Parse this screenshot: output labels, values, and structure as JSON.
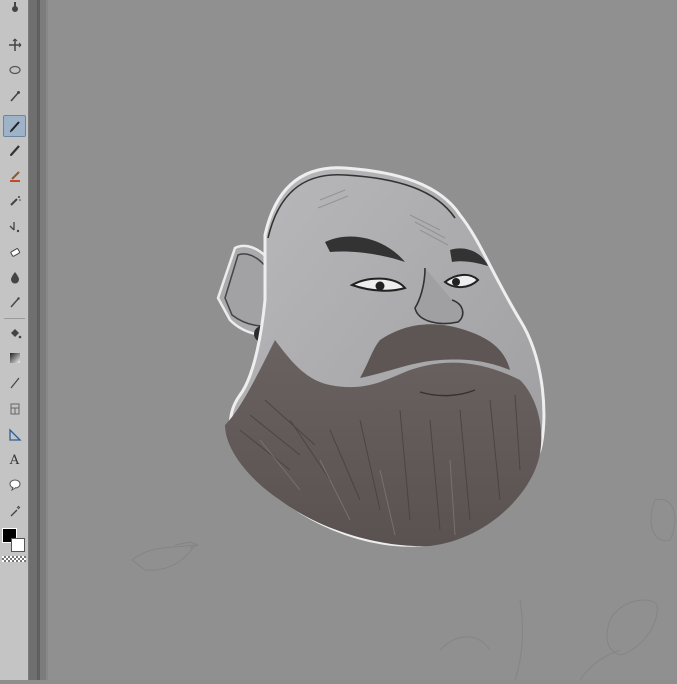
{
  "toolbar": {
    "tools": [
      {
        "icon": "eyedropper-icon",
        "active": false
      },
      {
        "icon": "move-icon",
        "active": false
      },
      {
        "icon": "lasso-icon",
        "active": false
      },
      {
        "icon": "magic-wand-icon",
        "active": false
      },
      {
        "icon": "pen-icon",
        "active": true
      },
      {
        "icon": "pencil-icon",
        "active": false
      },
      {
        "icon": "brush-icon",
        "active": false
      },
      {
        "icon": "airbrush-icon",
        "active": false
      },
      {
        "icon": "decoration-icon",
        "active": false
      },
      {
        "icon": "eraser-icon",
        "active": false
      },
      {
        "icon": "blend-icon",
        "active": false
      },
      {
        "icon": "eyedropper-small-icon",
        "active": false
      },
      {
        "icon": "fill-icon",
        "active": false
      },
      {
        "icon": "gradient-icon",
        "active": false
      },
      {
        "icon": "line-icon",
        "active": false
      },
      {
        "icon": "frame-icon",
        "active": false
      },
      {
        "icon": "ruler-icon",
        "active": false
      },
      {
        "icon": "text-icon",
        "active": false
      },
      {
        "icon": "balloon-icon",
        "active": false
      },
      {
        "icon": "correct-line-icon",
        "active": false
      }
    ],
    "text_tool_label": "A",
    "main_color": "#000000",
    "sub_color": "#ffffff"
  },
  "canvas": {
    "background": "#909090",
    "artwork": "bearded-man-caricature"
  }
}
